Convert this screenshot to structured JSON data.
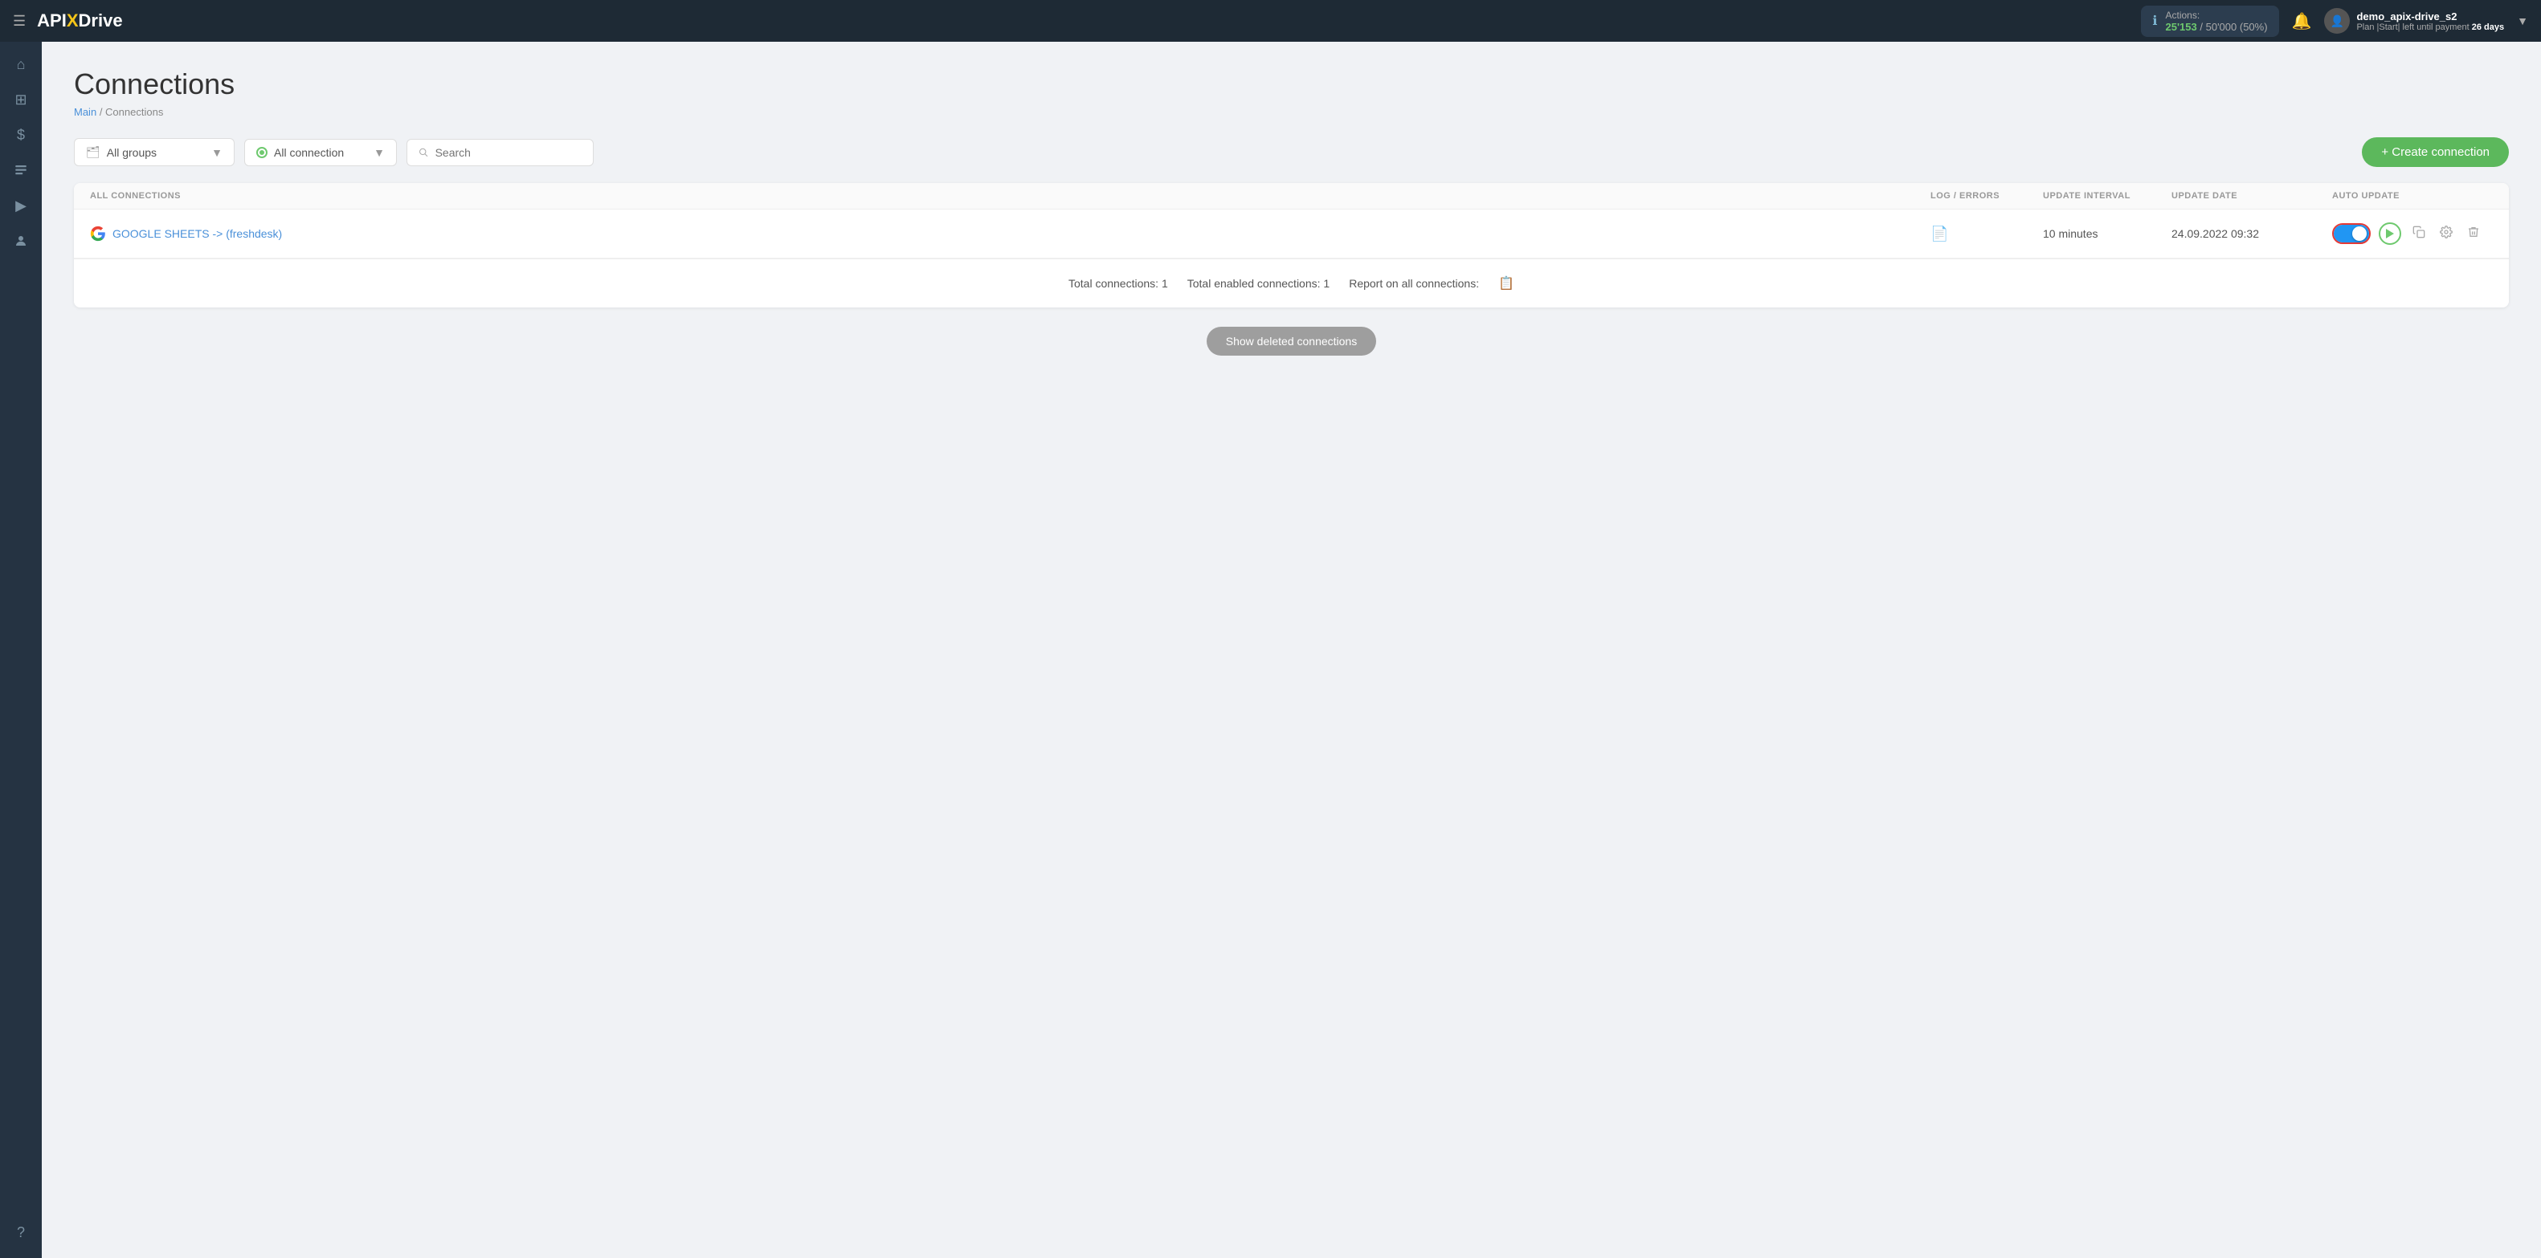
{
  "header": {
    "menu_label": "☰",
    "logo": {
      "part1": "API",
      "x": "X",
      "part2": "Drive"
    },
    "actions": {
      "label": "Actions:",
      "used": "25'153",
      "separator": " / ",
      "total": "50'000",
      "percent": "(50%)"
    },
    "bell_icon": "🔔",
    "user": {
      "name": "demo_apix-drive_s2",
      "plan_label": "Plan |Start| left until payment",
      "days": "26 days"
    }
  },
  "sidebar": {
    "items": [
      {
        "icon": "⌂",
        "label": "home",
        "active": false
      },
      {
        "icon": "⊞",
        "label": "connections",
        "active": false
      },
      {
        "icon": "$",
        "label": "billing",
        "active": false
      },
      {
        "icon": "💼",
        "label": "tasks",
        "active": false
      },
      {
        "icon": "▶",
        "label": "media",
        "active": false
      },
      {
        "icon": "👤",
        "label": "profile",
        "active": false
      },
      {
        "icon": "?",
        "label": "help",
        "active": false
      }
    ]
  },
  "page": {
    "title": "Connections",
    "breadcrumb_main": "Main",
    "breadcrumb_separator": " / ",
    "breadcrumb_current": "Connections"
  },
  "toolbar": {
    "groups_dropdown": {
      "icon": "folder",
      "label": "All groups",
      "placeholder": "All groups"
    },
    "connection_dropdown": {
      "label": "All connection"
    },
    "search_placeholder": "Search",
    "create_button": "+ Create connection"
  },
  "table": {
    "columns": [
      {
        "key": "name",
        "label": "ALL CONNECTIONS"
      },
      {
        "key": "log",
        "label": "LOG / ERRORS"
      },
      {
        "key": "interval",
        "label": "UPDATE INTERVAL"
      },
      {
        "key": "date",
        "label": "UPDATE DATE"
      },
      {
        "key": "autoupdate",
        "label": "AUTO UPDATE"
      }
    ],
    "rows": [
      {
        "id": 1,
        "name": "GOOGLE SHEETS -> (freshdesk)",
        "log_icon": "📄",
        "interval": "10 minutes",
        "date": "24.09.2022 09:32",
        "enabled": true
      }
    ],
    "footer": {
      "total_connections": "Total connections: 1",
      "total_enabled": "Total enabled connections: 1",
      "report_label": "Report on all connections:"
    }
  },
  "show_deleted_button": "Show deleted connections"
}
